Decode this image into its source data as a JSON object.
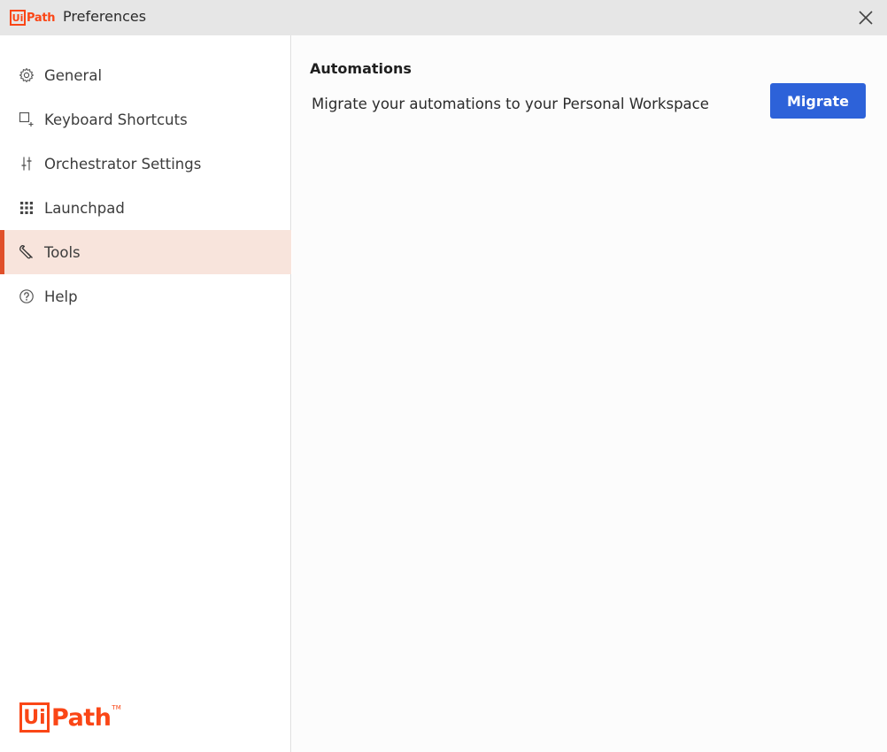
{
  "window": {
    "logo_box": "Ui",
    "logo_path": "Path",
    "title": "Preferences",
    "close_icon": "close-icon"
  },
  "sidebar": {
    "items": [
      {
        "id": "general",
        "label": "General",
        "icon": "gear-icon",
        "active": false
      },
      {
        "id": "keyboard-shortcuts",
        "label": "Keyboard Shortcuts",
        "icon": "keyboard-shortcut-icon",
        "active": false
      },
      {
        "id": "orchestrator-settings",
        "label": "Orchestrator Settings",
        "icon": "sliders-icon",
        "active": false
      },
      {
        "id": "launchpad",
        "label": "Launchpad",
        "icon": "grid-icon",
        "active": false
      },
      {
        "id": "tools",
        "label": "Tools",
        "icon": "wrench-icon",
        "active": true
      },
      {
        "id": "help",
        "label": "Help",
        "icon": "help-circle-icon",
        "active": false
      }
    ],
    "footer_logo": {
      "box": "Ui",
      "path": "Path",
      "tm": "TM"
    }
  },
  "main": {
    "section_title": "Automations",
    "migrate_row": {
      "description": "Migrate your automations to your Personal Workspace",
      "button_label": "Migrate"
    }
  },
  "colors": {
    "brand": "#fa4616",
    "active_bg": "#f8e4dc",
    "active_bar": "#e0502a",
    "primary_button": "#2d62d9",
    "titlebar_bg": "#e6e6e6"
  }
}
